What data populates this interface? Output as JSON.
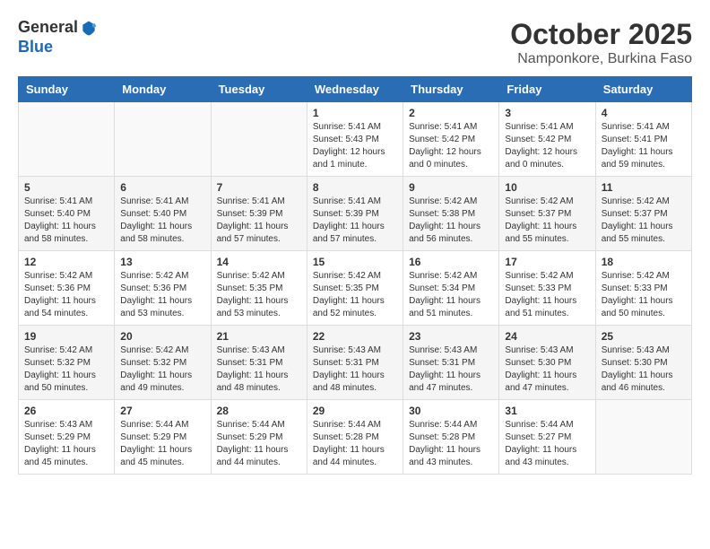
{
  "header": {
    "logo_line1": "General",
    "logo_line2": "Blue",
    "month": "October 2025",
    "location": "Namponkore, Burkina Faso"
  },
  "days_of_week": [
    "Sunday",
    "Monday",
    "Tuesday",
    "Wednesday",
    "Thursday",
    "Friday",
    "Saturday"
  ],
  "weeks": [
    [
      {
        "day": "",
        "info": ""
      },
      {
        "day": "",
        "info": ""
      },
      {
        "day": "",
        "info": ""
      },
      {
        "day": "1",
        "info": "Sunrise: 5:41 AM\nSunset: 5:43 PM\nDaylight: 12 hours\nand 1 minute."
      },
      {
        "day": "2",
        "info": "Sunrise: 5:41 AM\nSunset: 5:42 PM\nDaylight: 12 hours\nand 0 minutes."
      },
      {
        "day": "3",
        "info": "Sunrise: 5:41 AM\nSunset: 5:42 PM\nDaylight: 12 hours\nand 0 minutes."
      },
      {
        "day": "4",
        "info": "Sunrise: 5:41 AM\nSunset: 5:41 PM\nDaylight: 11 hours\nand 59 minutes."
      }
    ],
    [
      {
        "day": "5",
        "info": "Sunrise: 5:41 AM\nSunset: 5:40 PM\nDaylight: 11 hours\nand 58 minutes."
      },
      {
        "day": "6",
        "info": "Sunrise: 5:41 AM\nSunset: 5:40 PM\nDaylight: 11 hours\nand 58 minutes."
      },
      {
        "day": "7",
        "info": "Sunrise: 5:41 AM\nSunset: 5:39 PM\nDaylight: 11 hours\nand 57 minutes."
      },
      {
        "day": "8",
        "info": "Sunrise: 5:41 AM\nSunset: 5:39 PM\nDaylight: 11 hours\nand 57 minutes."
      },
      {
        "day": "9",
        "info": "Sunrise: 5:42 AM\nSunset: 5:38 PM\nDaylight: 11 hours\nand 56 minutes."
      },
      {
        "day": "10",
        "info": "Sunrise: 5:42 AM\nSunset: 5:37 PM\nDaylight: 11 hours\nand 55 minutes."
      },
      {
        "day": "11",
        "info": "Sunrise: 5:42 AM\nSunset: 5:37 PM\nDaylight: 11 hours\nand 55 minutes."
      }
    ],
    [
      {
        "day": "12",
        "info": "Sunrise: 5:42 AM\nSunset: 5:36 PM\nDaylight: 11 hours\nand 54 minutes."
      },
      {
        "day": "13",
        "info": "Sunrise: 5:42 AM\nSunset: 5:36 PM\nDaylight: 11 hours\nand 53 minutes."
      },
      {
        "day": "14",
        "info": "Sunrise: 5:42 AM\nSunset: 5:35 PM\nDaylight: 11 hours\nand 53 minutes."
      },
      {
        "day": "15",
        "info": "Sunrise: 5:42 AM\nSunset: 5:35 PM\nDaylight: 11 hours\nand 52 minutes."
      },
      {
        "day": "16",
        "info": "Sunrise: 5:42 AM\nSunset: 5:34 PM\nDaylight: 11 hours\nand 51 minutes."
      },
      {
        "day": "17",
        "info": "Sunrise: 5:42 AM\nSunset: 5:33 PM\nDaylight: 11 hours\nand 51 minutes."
      },
      {
        "day": "18",
        "info": "Sunrise: 5:42 AM\nSunset: 5:33 PM\nDaylight: 11 hours\nand 50 minutes."
      }
    ],
    [
      {
        "day": "19",
        "info": "Sunrise: 5:42 AM\nSunset: 5:32 PM\nDaylight: 11 hours\nand 50 minutes."
      },
      {
        "day": "20",
        "info": "Sunrise: 5:42 AM\nSunset: 5:32 PM\nDaylight: 11 hours\nand 49 minutes."
      },
      {
        "day": "21",
        "info": "Sunrise: 5:43 AM\nSunset: 5:31 PM\nDaylight: 11 hours\nand 48 minutes."
      },
      {
        "day": "22",
        "info": "Sunrise: 5:43 AM\nSunset: 5:31 PM\nDaylight: 11 hours\nand 48 minutes."
      },
      {
        "day": "23",
        "info": "Sunrise: 5:43 AM\nSunset: 5:31 PM\nDaylight: 11 hours\nand 47 minutes."
      },
      {
        "day": "24",
        "info": "Sunrise: 5:43 AM\nSunset: 5:30 PM\nDaylight: 11 hours\nand 47 minutes."
      },
      {
        "day": "25",
        "info": "Sunrise: 5:43 AM\nSunset: 5:30 PM\nDaylight: 11 hours\nand 46 minutes."
      }
    ],
    [
      {
        "day": "26",
        "info": "Sunrise: 5:43 AM\nSunset: 5:29 PM\nDaylight: 11 hours\nand 45 minutes."
      },
      {
        "day": "27",
        "info": "Sunrise: 5:44 AM\nSunset: 5:29 PM\nDaylight: 11 hours\nand 45 minutes."
      },
      {
        "day": "28",
        "info": "Sunrise: 5:44 AM\nSunset: 5:29 PM\nDaylight: 11 hours\nand 44 minutes."
      },
      {
        "day": "29",
        "info": "Sunrise: 5:44 AM\nSunset: 5:28 PM\nDaylight: 11 hours\nand 44 minutes."
      },
      {
        "day": "30",
        "info": "Sunrise: 5:44 AM\nSunset: 5:28 PM\nDaylight: 11 hours\nand 43 minutes."
      },
      {
        "day": "31",
        "info": "Sunrise: 5:44 AM\nSunset: 5:27 PM\nDaylight: 11 hours\nand 43 minutes."
      },
      {
        "day": "",
        "info": ""
      }
    ]
  ]
}
